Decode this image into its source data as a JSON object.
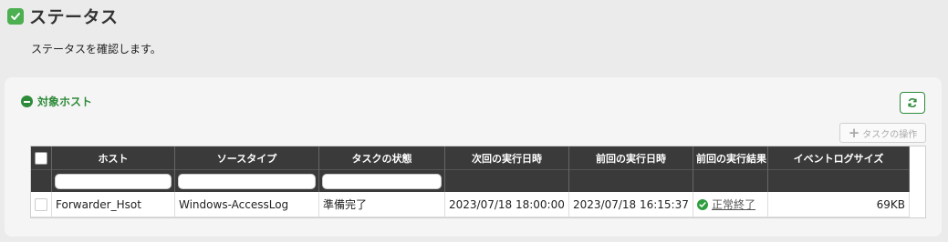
{
  "header": {
    "title": "ステータス",
    "description": "ステータスを確認します。"
  },
  "section": {
    "title": "対象ホスト"
  },
  "toolbar": {
    "task_operation_label": "タスクの操作"
  },
  "table": {
    "columns": [
      "ホスト",
      "ソースタイプ",
      "タスクの状態",
      "次回の実行日時",
      "前回の実行日時",
      "前回の実行結果",
      "イベントログサイズ"
    ],
    "rows": [
      {
        "host": "Forwarder_Hsot",
        "source_type": "Windows-AccessLog",
        "task_state": "準備完了",
        "next_run": "2023/07/18 18:00:00",
        "last_run": "2023/07/18 16:15:37",
        "last_result": "正常終了",
        "event_log_size": "69KB"
      }
    ]
  },
  "colors": {
    "accent_green": "#2e8b3a",
    "header_dark": "#3a3a3a",
    "ok_green": "#2e9e3e"
  },
  "icons": [
    "check-icon",
    "collapse-minus-icon",
    "refresh-icon",
    "plus-icon",
    "success-check-icon"
  ]
}
